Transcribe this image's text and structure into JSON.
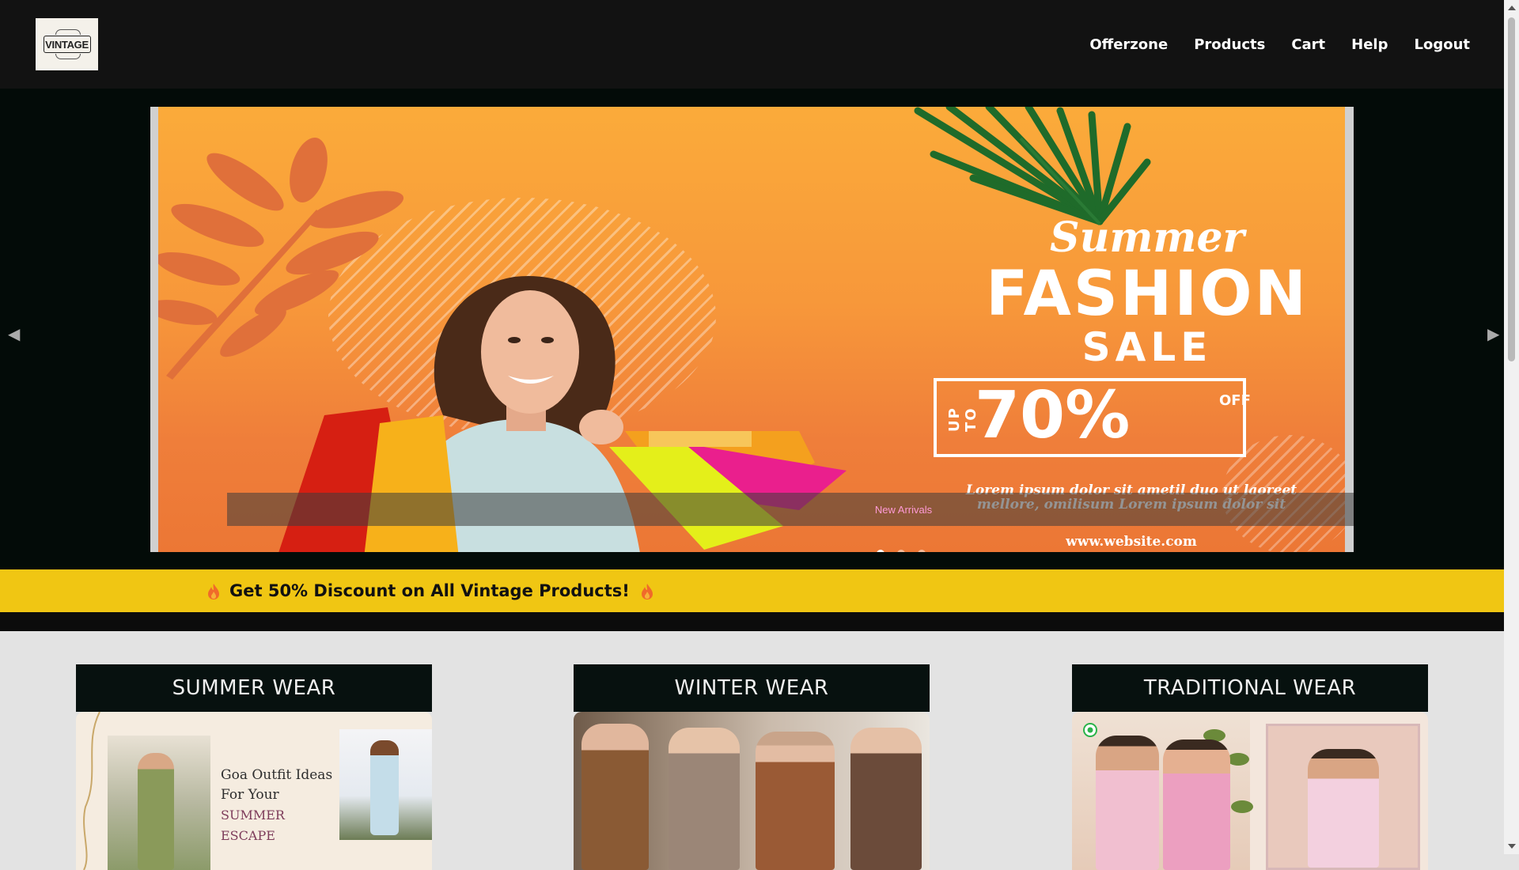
{
  "navbar": {
    "logo_text": "VINTAGE",
    "links": [
      "Offerzone",
      "Products",
      "Cart",
      "Help",
      "Logout"
    ]
  },
  "carousel": {
    "banner": {
      "line1": "Summer",
      "line2": "FASHION",
      "line3": "SALE",
      "upto": "UP TO",
      "percent": "70%",
      "off": "OFF",
      "lorem": "Lorem ipsum dolor sit ametil duo ut laoreet mellore, omilisum Lorem ipsum dolor sit",
      "website": "www.website.com"
    },
    "caption": "New Arrivals",
    "active_slide": 1,
    "slide_count": 3,
    "prev_icon": "◀",
    "next_icon": "▶"
  },
  "discount": {
    "text": "Get 50% Discount on All Vintage Products!"
  },
  "categories": [
    {
      "title": "SUMMER WEAR",
      "image_text": "Goa Outfit Ideas For Your",
      "image_subtext": "SUMMER ESCAPE"
    },
    {
      "title": "WINTER WEAR"
    },
    {
      "title": "TRADITIONAL WEAR"
    }
  ],
  "colors": {
    "navbar_bg": "#121212",
    "carousel_bg": "#030b08",
    "discount_bg": "#f0c613",
    "card_head_bg": "#07110f",
    "page_bg": "#e3e3e3"
  }
}
